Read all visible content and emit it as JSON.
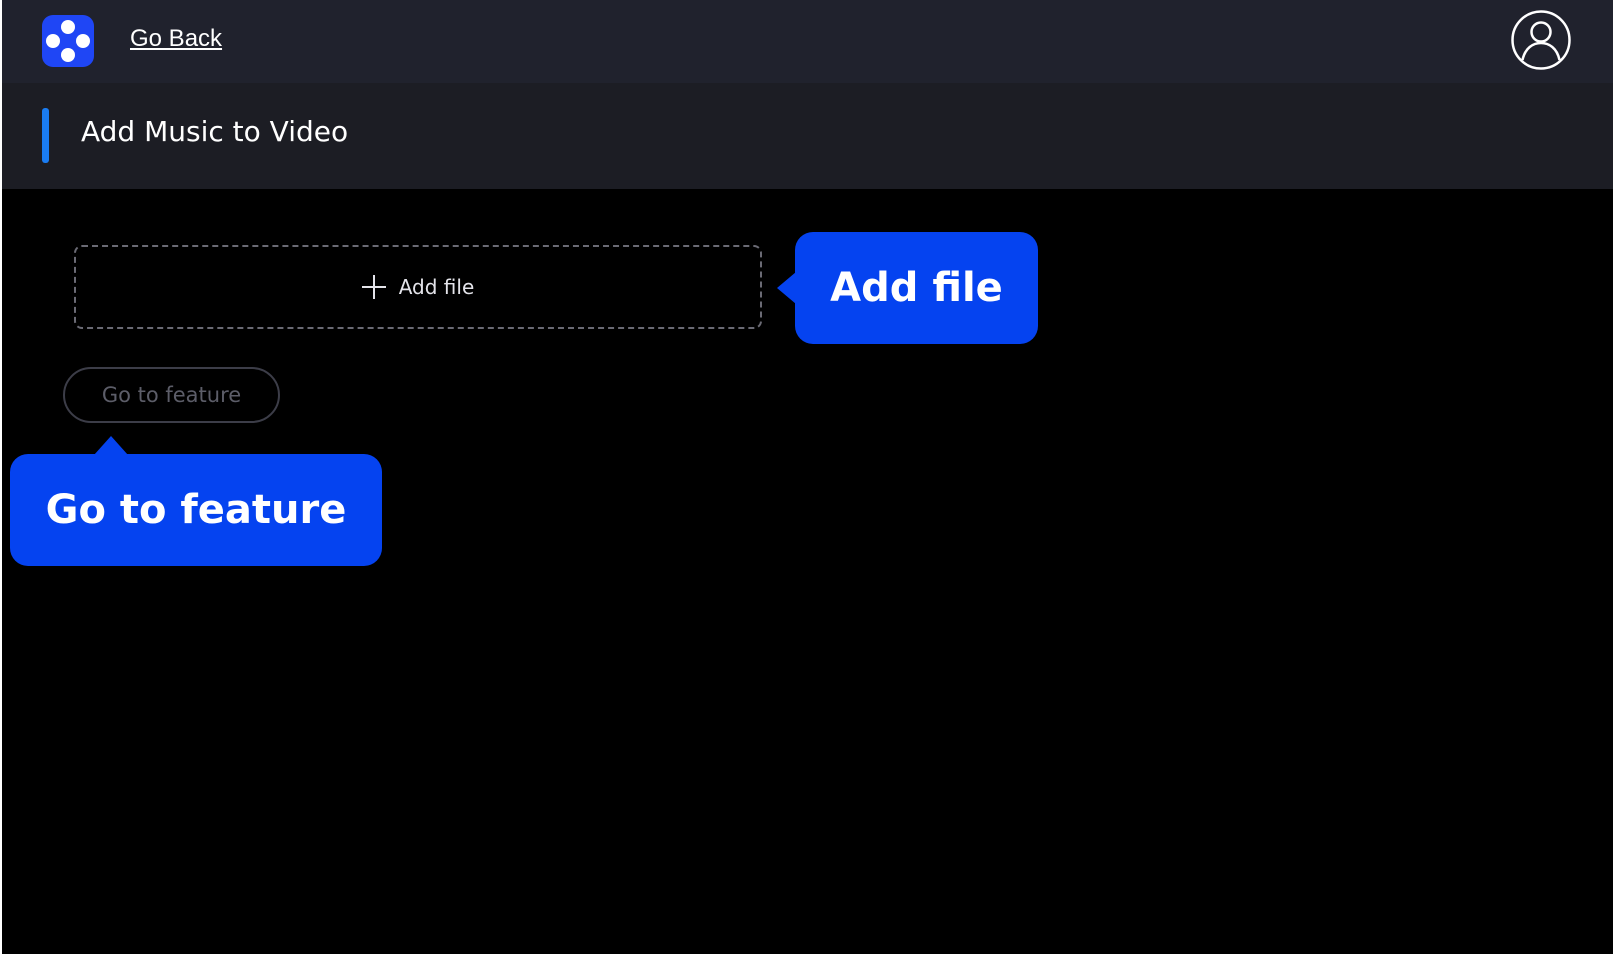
{
  "header": {
    "logo_icon": "app-logo-icon",
    "back_label": "Go Back",
    "account_icon": "user-account-icon"
  },
  "page": {
    "title": "Add Music to Video",
    "accent_color": "#1a7cf2"
  },
  "upload": {
    "icon": "plus-icon",
    "label": "Add file"
  },
  "actions": {
    "go_to_feature_label": "Go to feature"
  },
  "callouts": {
    "add_file": "Add file",
    "go_to_feature": "Go to feature",
    "color": "#0543f0"
  }
}
